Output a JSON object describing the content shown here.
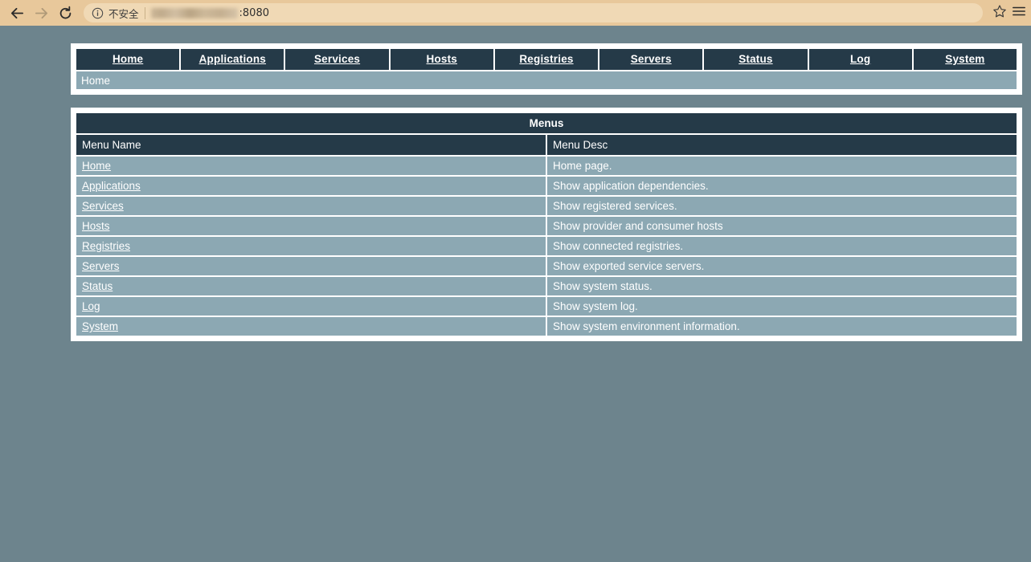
{
  "browser": {
    "back_icon": "arrow-left-icon",
    "forward_icon": "arrow-right-icon",
    "reload_icon": "reload-icon",
    "security_icon": "info-circle-icon",
    "security_label": "不安全",
    "url_port": ":8080",
    "bookmark_icon": "star-icon",
    "menu_icon": "hamburger-menu-icon",
    "chrome_bg": "#e8c89b",
    "omnibox_bg": "#f0d9b5"
  },
  "theme": {
    "page_bg": "#6d848d",
    "dark_bg": "#253a48",
    "row_bg": "#8ca8b3",
    "border": "#ffffff",
    "text": "#ffffff"
  },
  "nav": {
    "items": [
      {
        "label": "Home"
      },
      {
        "label": "Applications"
      },
      {
        "label": "Services"
      },
      {
        "label": "Hosts"
      },
      {
        "label": "Registries"
      },
      {
        "label": "Servers"
      },
      {
        "label": "Status"
      },
      {
        "label": "Log"
      },
      {
        "label": "System"
      }
    ]
  },
  "breadcrumb": {
    "text": "Home"
  },
  "menus_table": {
    "title": "Menus",
    "columns": [
      "Menu Name",
      "Menu Desc"
    ],
    "rows": [
      {
        "name": "Home",
        "desc": "Home page."
      },
      {
        "name": "Applications",
        "desc": "Show application dependencies."
      },
      {
        "name": "Services",
        "desc": "Show registered services."
      },
      {
        "name": "Hosts",
        "desc": "Show provider and consumer hosts"
      },
      {
        "name": "Registries",
        "desc": "Show connected registries."
      },
      {
        "name": "Servers",
        "desc": "Show exported service servers."
      },
      {
        "name": "Status",
        "desc": "Show system status."
      },
      {
        "name": "Log",
        "desc": "Show system log."
      },
      {
        "name": "System",
        "desc": "Show system environment information."
      }
    ]
  }
}
